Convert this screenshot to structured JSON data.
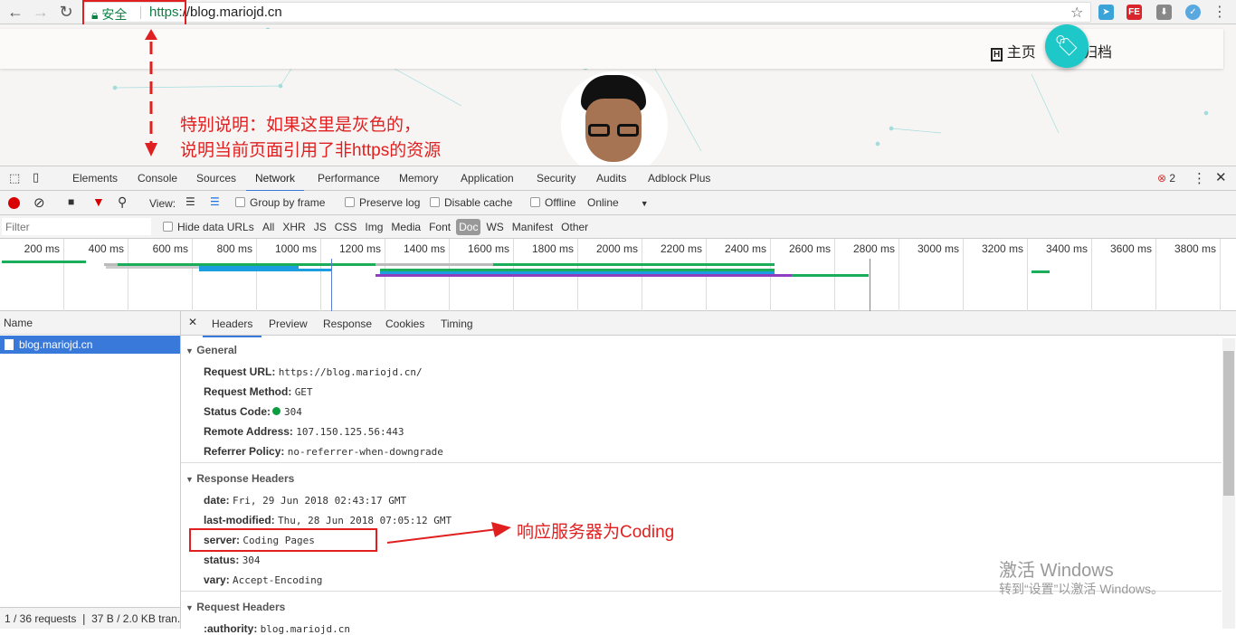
{
  "browser": {
    "security_label": "安全",
    "url_scheme": "https",
    "url_rest": "://blog.mariojd.cn",
    "extensions": [
      "send-icon",
      "fe-icon",
      "download-icon",
      "v-icon"
    ]
  },
  "site": {
    "nav": [
      {
        "icon": "h-icon",
        "label": "主页"
      },
      {
        "label": "归档"
      }
    ]
  },
  "annotations": {
    "top_note_line1": "特别说明：如果这里是灰色的，",
    "top_note_line2": "说明当前页面引用了非https的资源",
    "server_note": "响应服务器为Coding"
  },
  "devtools": {
    "tabs": [
      "Elements",
      "Console",
      "Sources",
      "Network",
      "Performance",
      "Memory",
      "Application",
      "Security",
      "Audits",
      "Adblock Plus"
    ],
    "active_tab": "Network",
    "error_count": "2",
    "toolbar": {
      "view_label": "View:",
      "group_by_frame": "Group by frame",
      "preserve_log": "Preserve log",
      "disable_cache": "Disable cache",
      "offline": "Offline",
      "throttle": "Online"
    },
    "filter": {
      "placeholder": "Filter",
      "hide_data_urls": "Hide data URLs",
      "types": [
        "All",
        "XHR",
        "JS",
        "CSS",
        "Img",
        "Media",
        "Font",
        "Doc",
        "WS",
        "Manifest",
        "Other"
      ],
      "active_type": "Doc"
    },
    "timeline_ticks": [
      "200 ms",
      "400 ms",
      "600 ms",
      "800 ms",
      "1000 ms",
      "1200 ms",
      "1400 ms",
      "1600 ms",
      "1800 ms",
      "2000 ms",
      "2200 ms",
      "2400 ms",
      "2600 ms",
      "2800 ms",
      "3000 ms",
      "3200 ms",
      "3400 ms",
      "3600 ms",
      "3800 ms"
    ],
    "name_header": "Name",
    "requests": [
      "blog.mariojd.cn"
    ],
    "status_bar": "1 / 36 requests  ❘  37 B / 2.0 KB tran...",
    "detail_tabs": [
      "Headers",
      "Preview",
      "Response",
      "Cookies",
      "Timing"
    ],
    "active_detail_tab": "Headers",
    "general": {
      "title": "General",
      "rows": [
        {
          "key": "Request URL:",
          "value": "https://blog.mariojd.cn/"
        },
        {
          "key": "Request Method:",
          "value": "GET"
        },
        {
          "key": "Status Code:",
          "value": "304",
          "status_color": "#0a9e3c"
        },
        {
          "key": "Remote Address:",
          "value": "107.150.125.56:443"
        },
        {
          "key": "Referrer Policy:",
          "value": "no-referrer-when-downgrade"
        }
      ]
    },
    "response_headers": {
      "title": "Response Headers",
      "rows": [
        {
          "key": "date:",
          "value": "Fri, 29 Jun 2018 02:43:17 GMT"
        },
        {
          "key": "last-modified:",
          "value": "Thu, 28 Jun 2018 07:05:12 GMT"
        },
        {
          "key": "server:",
          "value": "Coding Pages"
        },
        {
          "key": "status:",
          "value": "304"
        },
        {
          "key": "vary:",
          "value": "Accept-Encoding"
        }
      ]
    },
    "request_headers": {
      "title": "Request Headers",
      "rows": [
        {
          "key": ":authority:",
          "value": "blog.mariojd.cn"
        }
      ]
    }
  },
  "watermark": {
    "line1": "激活 Windows",
    "line2": "转到“设置”以激活 Windows。"
  }
}
